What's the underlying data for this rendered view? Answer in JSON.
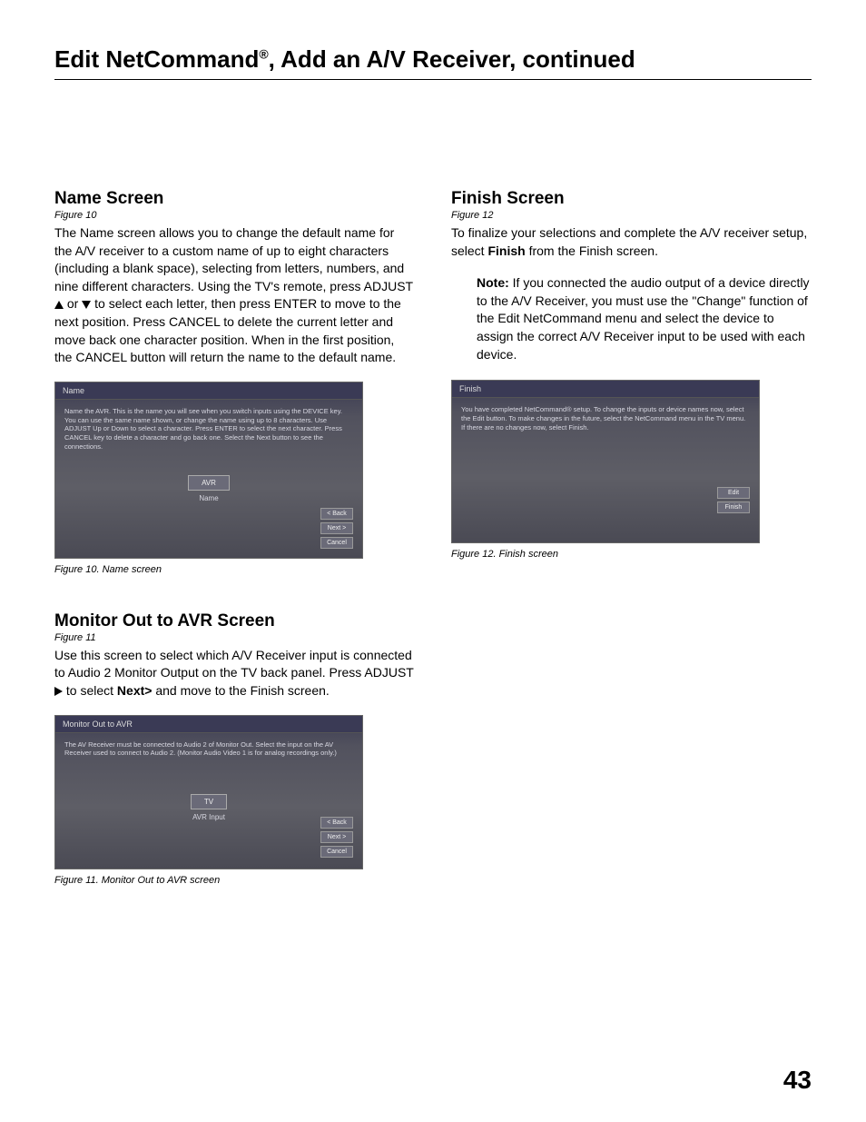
{
  "page": {
    "title_prefix": "Edit NetCommand",
    "title_suffix": ", Add an A/V Receiver, continued",
    "number": "43"
  },
  "name_section": {
    "heading": "Name Screen",
    "figure_ref": "Figure 10",
    "body_before_icons": "The Name screen allows you to change the default name for the A/V receiver to a custom name of up to eight characters (including a blank space), selecting from letters, numbers, and nine different characters. Using the TV's remote, press ADJUST ",
    "body_mid": " or ",
    "body_after_icons": " to select each letter, then press ENTER to move to the next position.  Press CANCEL to delete the current letter and move back one character position.  When in the first position, the CANCEL button will return the name to the default name.",
    "caption": "Figure 10.  Name screen",
    "shot": {
      "titlebar": "Name",
      "text": "Name the AVR.  This is the name you will see when you switch inputs using the DEVICE key.  You can use the same name shown, or change the name using up to 8 characters. Use ADJUST Up or Down to select a character.  Press ENTER to select the next character.  Press CANCEL key to delete a character and go back one.  Select the Next button to see the connections.",
      "input_value": "AVR",
      "input_label": "Name",
      "btn_back": "< Back",
      "btn_next": "Next >",
      "btn_cancel": "Cancel"
    }
  },
  "monitor_section": {
    "heading": "Monitor Out to AVR Screen",
    "figure_ref": "Figure 11",
    "body_before": "Use this screen to select which A/V Receiver input is connected to Audio 2 Monitor Output on the TV back panel.  Press ADJUST ",
    "body_mid1": " to select ",
    "next_label": "Next>",
    "body_after": " and move to the Finish screen.",
    "caption": "Figure 11. Monitor Out to AVR screen",
    "shot": {
      "titlebar": "Monitor Out to AVR",
      "text": "The AV Receiver must be connected to Audio 2 of Monitor Out.  Select the input on the AV Receiver used to connect to Audio 2.  (Monitor Audio Video 1 is for analog recordings only.)",
      "input_value": "TV",
      "input_label": "AVR Input",
      "btn_back": "< Back",
      "btn_next": "Next >",
      "btn_cancel": "Cancel"
    }
  },
  "finish_section": {
    "heading": "Finish Screen",
    "figure_ref": "Figure 12",
    "body_before": "To finalize your selections and complete the A/V receiver setup, select ",
    "finish_word": "Finish",
    "body_after": " from the Finish screen.",
    "note_label": "Note:",
    "note_body": " If you connected the audio output of a device directly to the A/V Receiver, you must use the \"Change\" function of the Edit NetCommand menu and select the device to assign the correct A/V Receiver input to be used with each device.",
    "caption": "Figure 12.  Finish screen",
    "shot": {
      "titlebar": "Finish",
      "text": "You have completed NetCommand® setup.  To change the inputs or device names now, select the Edit button.  To make changes in the future, select the NetCommand menu in the TV menu.  If there are no changes now, select Finish.",
      "btn_edit": "Edit",
      "btn_finish": "Finish"
    }
  }
}
